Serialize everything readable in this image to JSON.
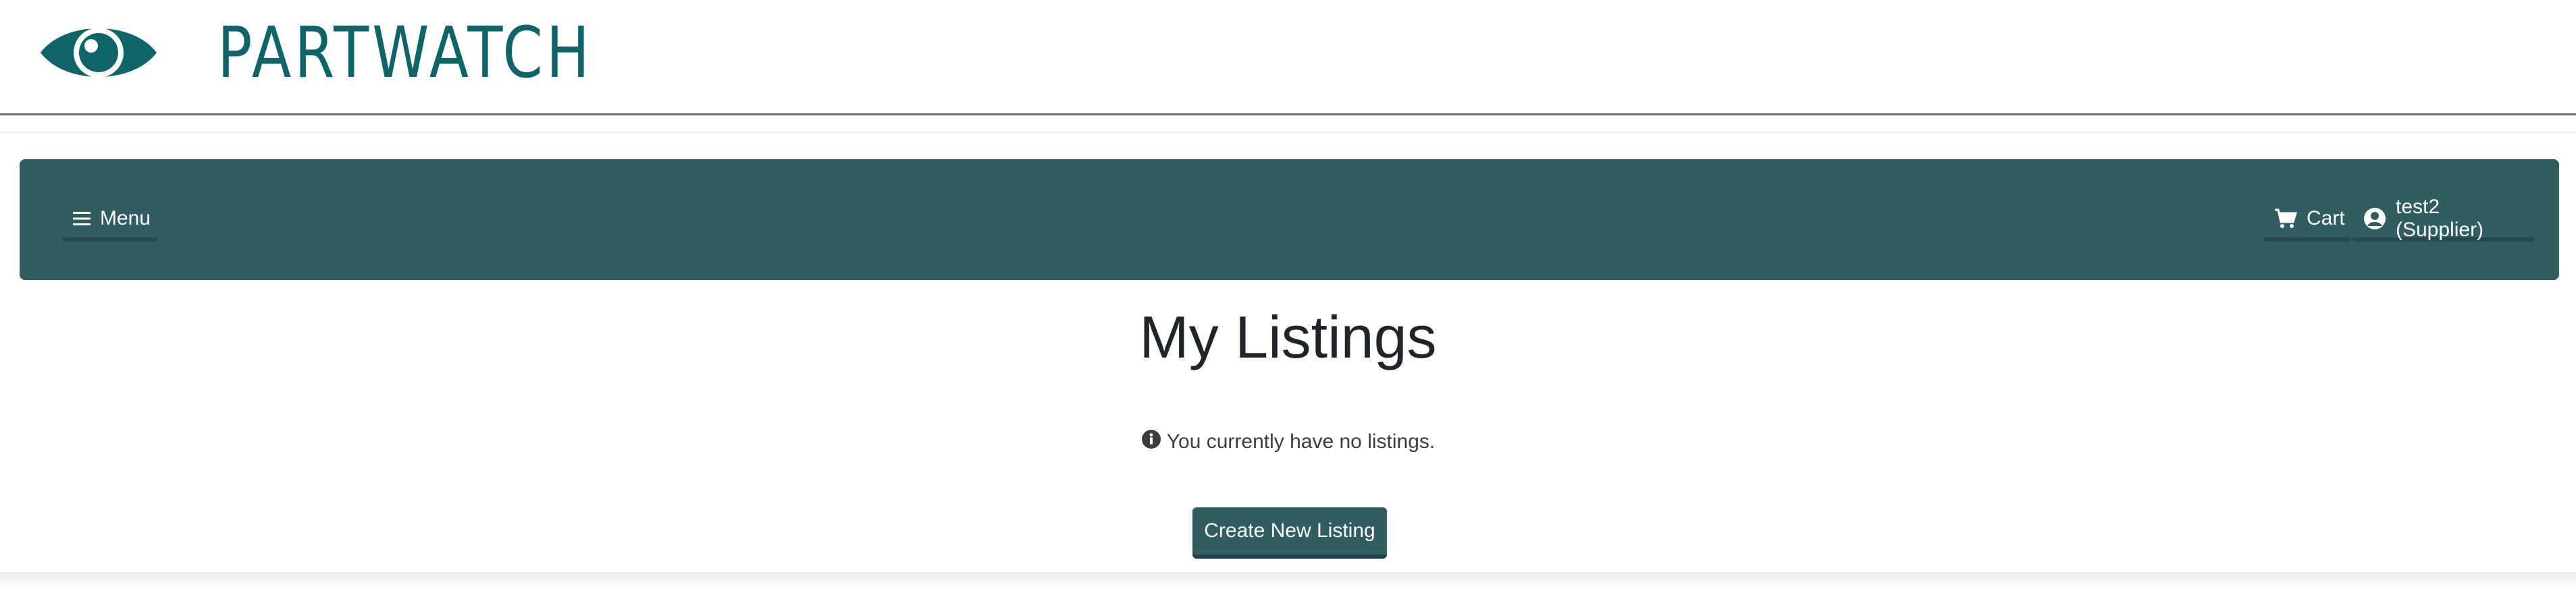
{
  "header": {
    "logo_text": "PARTWATCH",
    "logo_icon": "eye-icon",
    "brand_color": "#0e6467"
  },
  "navbar": {
    "menu_label": "Menu",
    "menu_icon": "hamburger-icon",
    "cart_label": "Cart",
    "cart_icon": "cart-icon",
    "user_label": "test2 (Supplier)",
    "user_icon": "user-circle-icon",
    "background_color": "#2f5d62"
  },
  "main": {
    "title": "My Listings",
    "empty_message": "You currently have no listings.",
    "empty_icon": "info-circle-icon",
    "create_button_label": "Create New Listing"
  }
}
